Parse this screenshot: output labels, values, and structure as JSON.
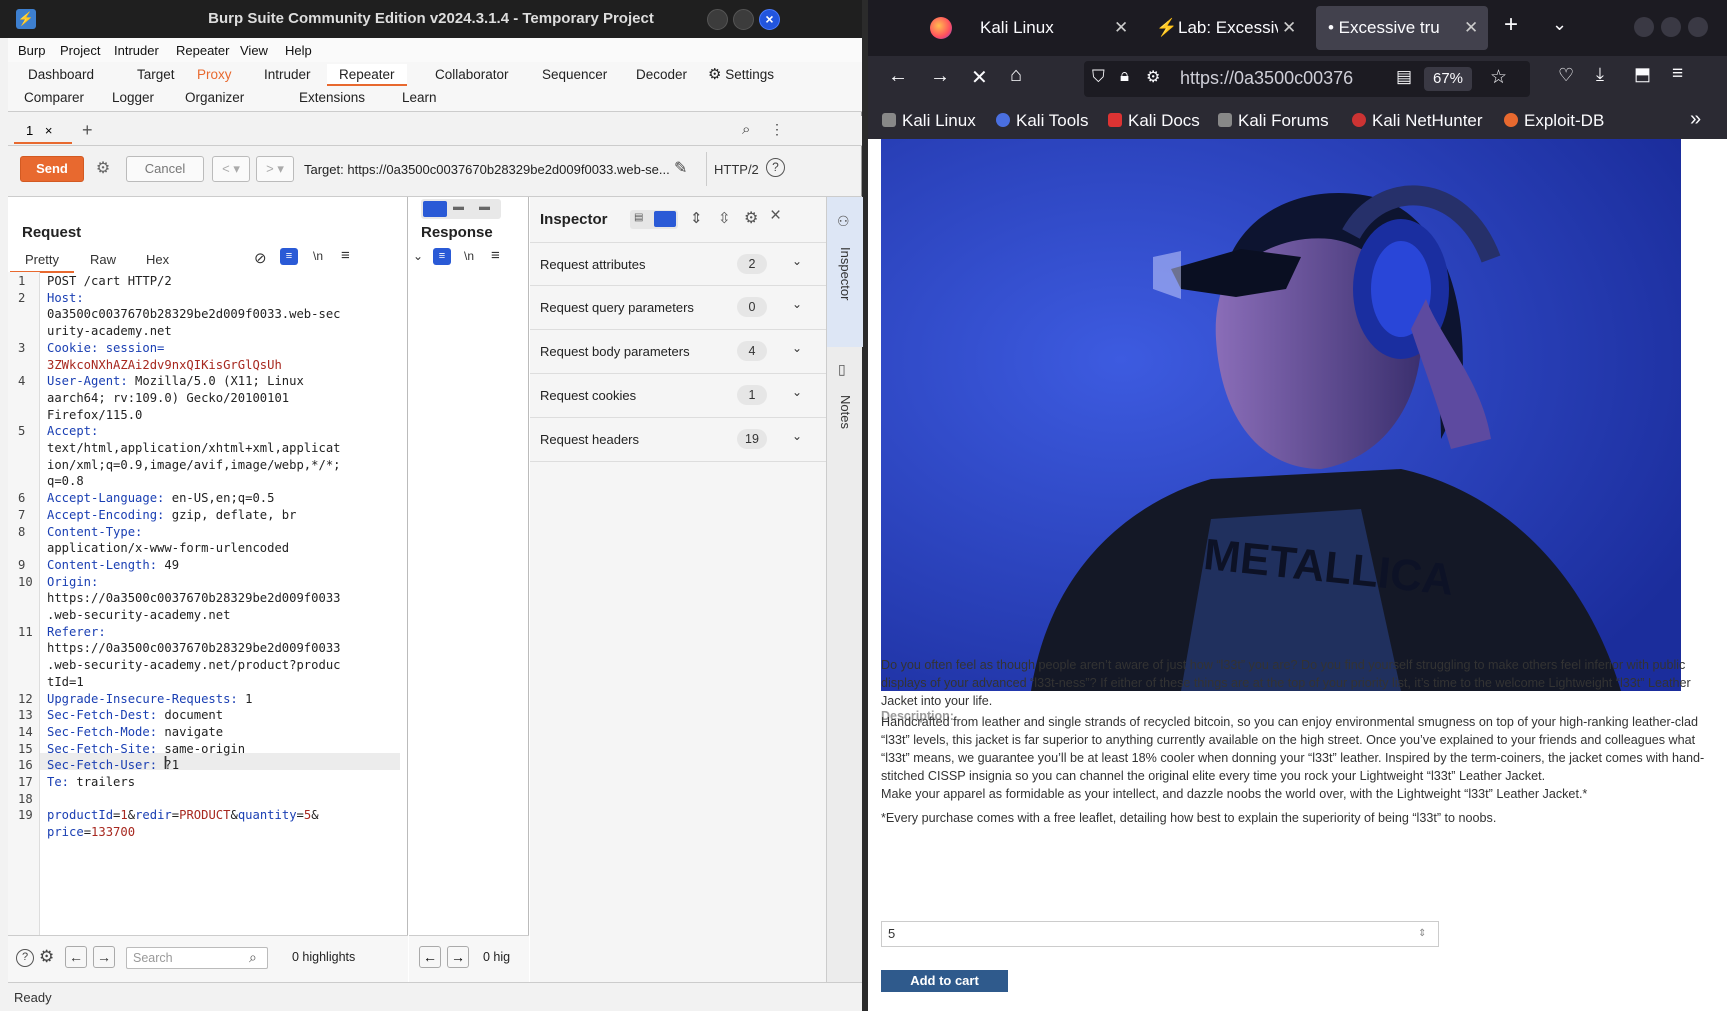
{
  "burp": {
    "title": "Burp Suite Community Edition v2024.3.1.4 - Temporary Project",
    "menu": [
      "Burp",
      "Project",
      "Intruder",
      "Repeater",
      "View",
      "Help"
    ],
    "tabs_row1": [
      "Dashboard",
      "Target",
      "Proxy",
      "Intruder",
      "Repeater",
      "Collaborator",
      "Sequencer",
      "Decoder",
      "Settings"
    ],
    "tabs_row2": [
      "Comparer",
      "Logger",
      "Organizer",
      "Extensions",
      "Learn"
    ],
    "repeater_tab": "1",
    "send": "Send",
    "cancel": "Cancel",
    "target": "Target: https://0a3500c0037670b28329be2d009f0033.web-se...",
    "http_version": "HTTP/2",
    "request": {
      "heading": "Request",
      "view_tabs": [
        "Pretty",
        "Raw",
        "Hex"
      ],
      "wrap_toggle": "\\n",
      "lines": [
        {
          "n": "1",
          "segs": [
            {
              "t": "POST /cart HTTP/2",
              "c": "p"
            }
          ]
        },
        {
          "n": "2",
          "segs": [
            {
              "t": "Host:",
              "c": "k"
            }
          ]
        },
        {
          "n": "",
          "segs": [
            {
              "t": "0a3500c0037670b28329be2d009f0033.web-sec",
              "c": "p"
            }
          ]
        },
        {
          "n": "",
          "segs": [
            {
              "t": "urity-academy.net",
              "c": "p"
            }
          ]
        },
        {
          "n": "3",
          "segs": [
            {
              "t": "Cookie: session=",
              "c": "k"
            }
          ]
        },
        {
          "n": "",
          "segs": [
            {
              "t": "3ZWkcoNXhAZAi2dv9nxQIKisGrGlQsUh",
              "c": "v"
            }
          ]
        },
        {
          "n": "4",
          "segs": [
            {
              "t": "User-Agent:",
              "c": "k"
            },
            {
              "t": " Mozilla/5.0 (X11; Linux",
              "c": "p"
            }
          ]
        },
        {
          "n": "",
          "segs": [
            {
              "t": "aarch64; rv:109.0) Gecko/20100101",
              "c": "p"
            }
          ]
        },
        {
          "n": "",
          "segs": [
            {
              "t": "Firefox/115.0",
              "c": "p"
            }
          ]
        },
        {
          "n": "5",
          "segs": [
            {
              "t": "Accept:",
              "c": "k"
            }
          ]
        },
        {
          "n": "",
          "segs": [
            {
              "t": "text/html,application/xhtml+xml,applicat",
              "c": "p"
            }
          ]
        },
        {
          "n": "",
          "segs": [
            {
              "t": "ion/xml;q=0.9,image/avif,image/webp,*/*;",
              "c": "p"
            }
          ]
        },
        {
          "n": "",
          "segs": [
            {
              "t": "q=0.8",
              "c": "p"
            }
          ]
        },
        {
          "n": "6",
          "segs": [
            {
              "t": "Accept-Language:",
              "c": "k"
            },
            {
              "t": " en-US,en;q=0.5",
              "c": "p"
            }
          ]
        },
        {
          "n": "7",
          "segs": [
            {
              "t": "Accept-Encoding:",
              "c": "k"
            },
            {
              "t": " gzip, deflate, br",
              "c": "p"
            }
          ]
        },
        {
          "n": "8",
          "segs": [
            {
              "t": "Content-Type:",
              "c": "k"
            }
          ]
        },
        {
          "n": "",
          "segs": [
            {
              "t": "application/x-www-form-urlencoded",
              "c": "p"
            }
          ]
        },
        {
          "n": "9",
          "segs": [
            {
              "t": "Content-Length:",
              "c": "k"
            },
            {
              "t": " 49",
              "c": "p"
            }
          ]
        },
        {
          "n": "10",
          "segs": [
            {
              "t": "Origin:",
              "c": "k"
            }
          ]
        },
        {
          "n": "",
          "segs": [
            {
              "t": "https://0a3500c0037670b28329be2d009f0033",
              "c": "p"
            }
          ]
        },
        {
          "n": "",
          "segs": [
            {
              "t": ".web-security-academy.net",
              "c": "p"
            }
          ]
        },
        {
          "n": "11",
          "segs": [
            {
              "t": "Referer:",
              "c": "k"
            }
          ]
        },
        {
          "n": "",
          "segs": [
            {
              "t": "https://0a3500c0037670b28329be2d009f0033",
              "c": "p"
            }
          ]
        },
        {
          "n": "",
          "segs": [
            {
              "t": ".web-security-academy.net/product?produc",
              "c": "p"
            }
          ]
        },
        {
          "n": "",
          "segs": [
            {
              "t": "tId=1",
              "c": "p"
            }
          ]
        },
        {
          "n": "12",
          "segs": [
            {
              "t": "Upgrade-Insecure-Requests:",
              "c": "k"
            },
            {
              "t": " 1",
              "c": "p"
            }
          ]
        },
        {
          "n": "13",
          "segs": [
            {
              "t": "Sec-Fetch-Dest:",
              "c": "k"
            },
            {
              "t": " document",
              "c": "p"
            }
          ]
        },
        {
          "n": "14",
          "segs": [
            {
              "t": "Sec-Fetch-Mode:",
              "c": "k"
            },
            {
              "t": " navigate",
              "c": "p"
            }
          ]
        },
        {
          "n": "15",
          "segs": [
            {
              "t": "Sec-Fetch-Site:",
              "c": "k"
            },
            {
              "t": " same-origin",
              "c": "p"
            }
          ]
        },
        {
          "n": "16",
          "segs": [
            {
              "t": "Sec-Fetch-User:",
              "c": "k"
            },
            {
              "t": " ?1",
              "c": "p"
            }
          ]
        },
        {
          "n": "17",
          "segs": [
            {
              "t": "Te:",
              "c": "k"
            },
            {
              "t": " trailers",
              "c": "p"
            }
          ]
        },
        {
          "n": "18",
          "segs": []
        },
        {
          "n": "19",
          "segs": [
            {
              "t": "productId",
              "c": "k"
            },
            {
              "t": "=",
              "c": "p"
            },
            {
              "t": "1",
              "c": "v"
            },
            {
              "t": "&",
              "c": "p"
            },
            {
              "t": "redir",
              "c": "k"
            },
            {
              "t": "=",
              "c": "p"
            },
            {
              "t": "PRODUCT",
              "c": "v"
            },
            {
              "t": "&",
              "c": "p"
            },
            {
              "t": "quantity",
              "c": "k"
            },
            {
              "t": "=",
              "c": "p"
            },
            {
              "t": "5",
              "c": "v"
            },
            {
              "t": "&",
              "c": "p"
            }
          ]
        },
        {
          "n": "",
          "segs": [
            {
              "t": "price",
              "c": "k"
            },
            {
              "t": "=",
              "c": "p"
            },
            {
              "t": "133700",
              "c": "v"
            }
          ]
        }
      ],
      "search_placeholder": "Search",
      "highlights": "0 highlights"
    },
    "response": {
      "heading": "Response",
      "wrap_toggle": "\\n",
      "highlights": "0 hig"
    },
    "inspector": {
      "heading": "Inspector",
      "rows": [
        {
          "label": "Request attributes",
          "count": "2"
        },
        {
          "label": "Request query parameters",
          "count": "0"
        },
        {
          "label": "Request body parameters",
          "count": "4"
        },
        {
          "label": "Request cookies",
          "count": "1"
        },
        {
          "label": "Request headers",
          "count": "19"
        }
      ],
      "side_tabs": [
        "Inspector",
        "Notes"
      ]
    },
    "status": "Ready"
  },
  "firefox": {
    "tabs": [
      {
        "label": "Kali Linux"
      },
      {
        "label": "Lab: Excessiv"
      },
      {
        "label": "• Excessive tru"
      }
    ],
    "url": "https://0a3500c00376",
    "zoom": "67%",
    "bookmarks": [
      "Kali Linux",
      "Kali Tools",
      "Kali Docs",
      "Kali Forums",
      "Kali NetHunter",
      "Exploit-DB"
    ],
    "page": {
      "image_text": "METALLICA",
      "description_label": "Description:",
      "paragraphs": [
        "Do you often feel as though people aren’t aware of just how “l33t” you are? Do you find yourself struggling to make others feel inferior with public displays of your advanced “l33t-ness”? If either of these things are at the top of your priority list, it’s time to the welcome Lightweight “l33t” Leather Jacket into your life.",
        "Handcrafted from leather and single strands of recycled bitcoin, so you can enjoy environmental smugness on top of your high-ranking leather-clad “l33t” levels, this jacket is far superior to anything currently available on the high street. Once you’ve explained to your friends and colleagues what “l33t” means, we guarantee you’ll be at least 18% cooler when donning your “l33t” leather. Inspired by the term-coiners, the jacket comes with hand-stitched CISSP insignia so you can channel the original elite every time you rock your Lightweight “l33t” Leather Jacket.",
        "Make your apparel as formidable as your intellect, and dazzle noobs the world over, with the Lightweight “l33t” Leather Jacket.*",
        "*Every purchase comes with a free leaflet, detailing how best to explain the superiority of being “l33t” to noobs."
      ],
      "quantity": "5",
      "add_to_cart": "Add to cart"
    }
  }
}
